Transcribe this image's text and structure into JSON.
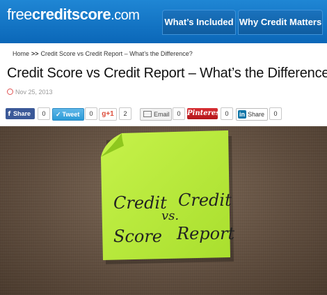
{
  "header": {
    "logo": {
      "free": "free",
      "credit": "credit",
      "score": "score",
      "dotcom": ".com"
    },
    "nav": [
      "What’s Included",
      "Why Credit Matters"
    ]
  },
  "breadcrumb": {
    "home": "Home",
    "sep": ">>",
    "current": "Credit Score vs Credit Report – What’s the Difference?"
  },
  "article": {
    "title": "Credit Score vs Credit Report – What’s the Difference?",
    "date": "Nov 25, 2013"
  },
  "share": {
    "facebook": {
      "label": "Share",
      "count": "0"
    },
    "twitter": {
      "label": "Tweet",
      "count": "0"
    },
    "googleplus": {
      "label": "g+1",
      "count": "2"
    },
    "email": {
      "label": "Email",
      "count": "0"
    },
    "pinterest": {
      "label": "Pinterest",
      "count": "0"
    },
    "linkedin": {
      "label": "Share",
      "icon_text": "in",
      "count": "0"
    }
  },
  "image": {
    "note_text": {
      "credit1": "Credit",
      "vs": "vs.",
      "credit2": "Credit",
      "score": "Score",
      "report": "Report"
    }
  },
  "colors": {
    "header_blue": "#0b67b8",
    "note_green": "#b9ec3a",
    "wall_brown": "#6a5644"
  }
}
